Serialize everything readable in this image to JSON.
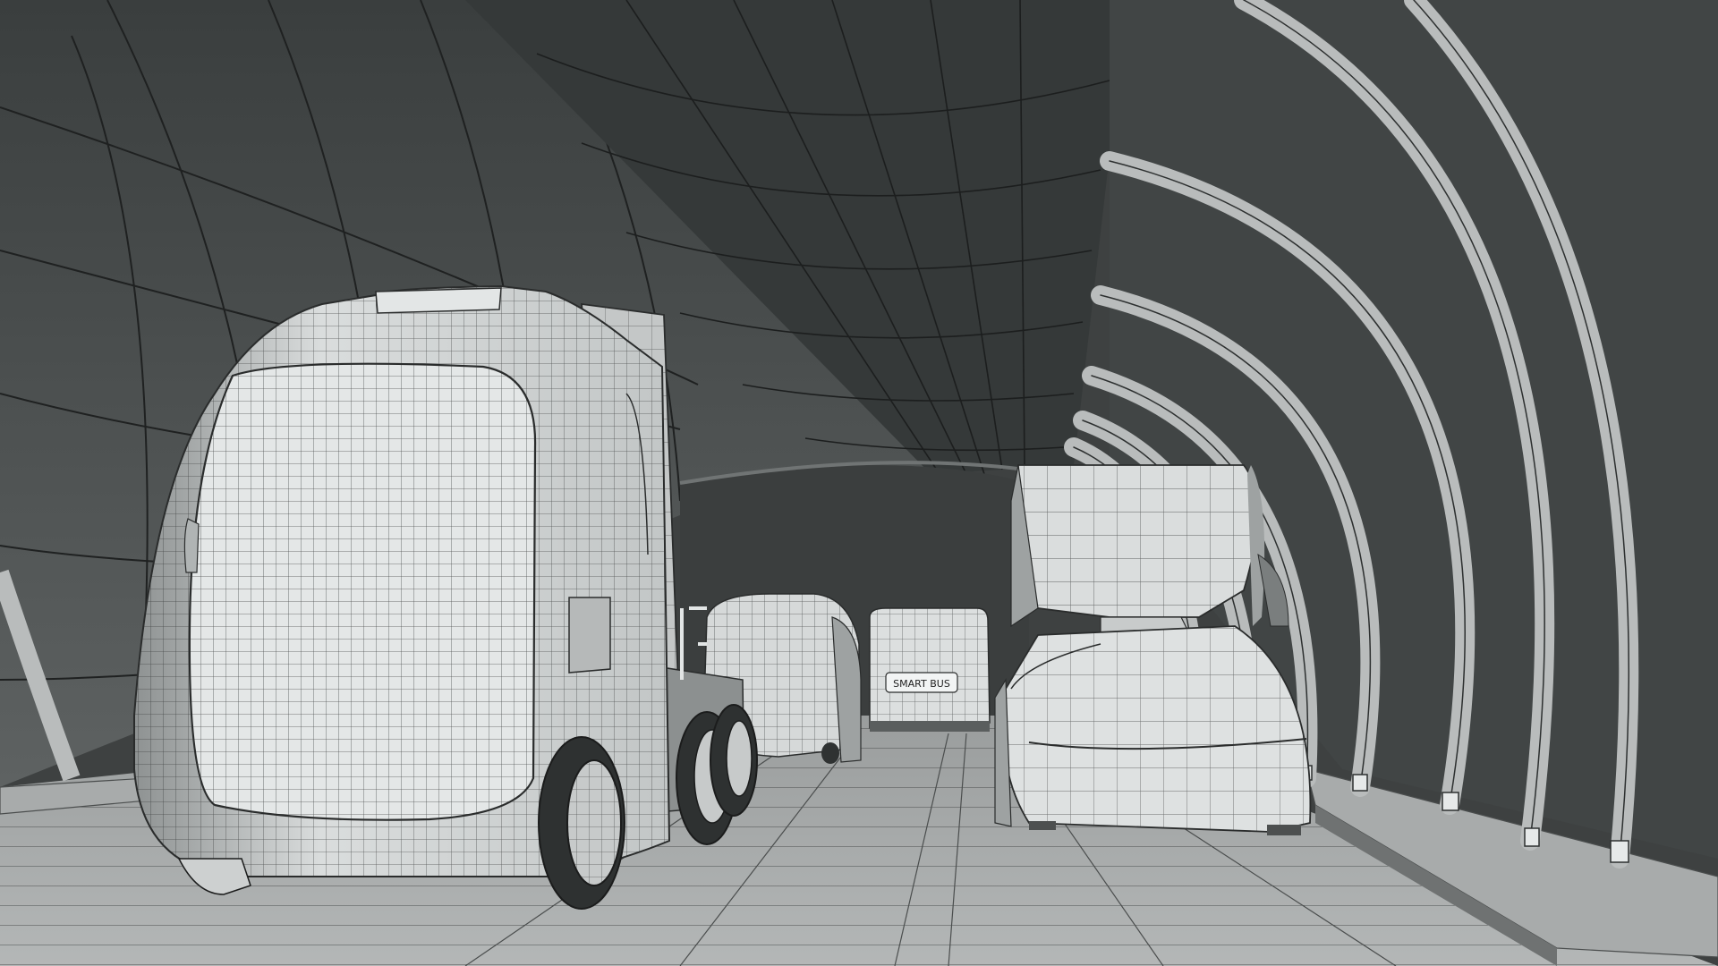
{
  "scene": {
    "description_tags": [
      "tunnel",
      "wireframe",
      "autonomous-vehicles"
    ],
    "colors": {
      "tunnel_dark": "#3a3d3d",
      "tunnel_mid": "#505454",
      "tunnel_light": "#6e7272",
      "floor": "#8f9292",
      "floor_light": "#b5b8b8",
      "vehicle_body": "#d9dcdc",
      "vehicle_shadow": "#9ea2a2",
      "wire": "#2a2c2c",
      "arch": "#a8acab"
    }
  },
  "vehicles": {
    "bus_sign": "SMART BUS"
  }
}
